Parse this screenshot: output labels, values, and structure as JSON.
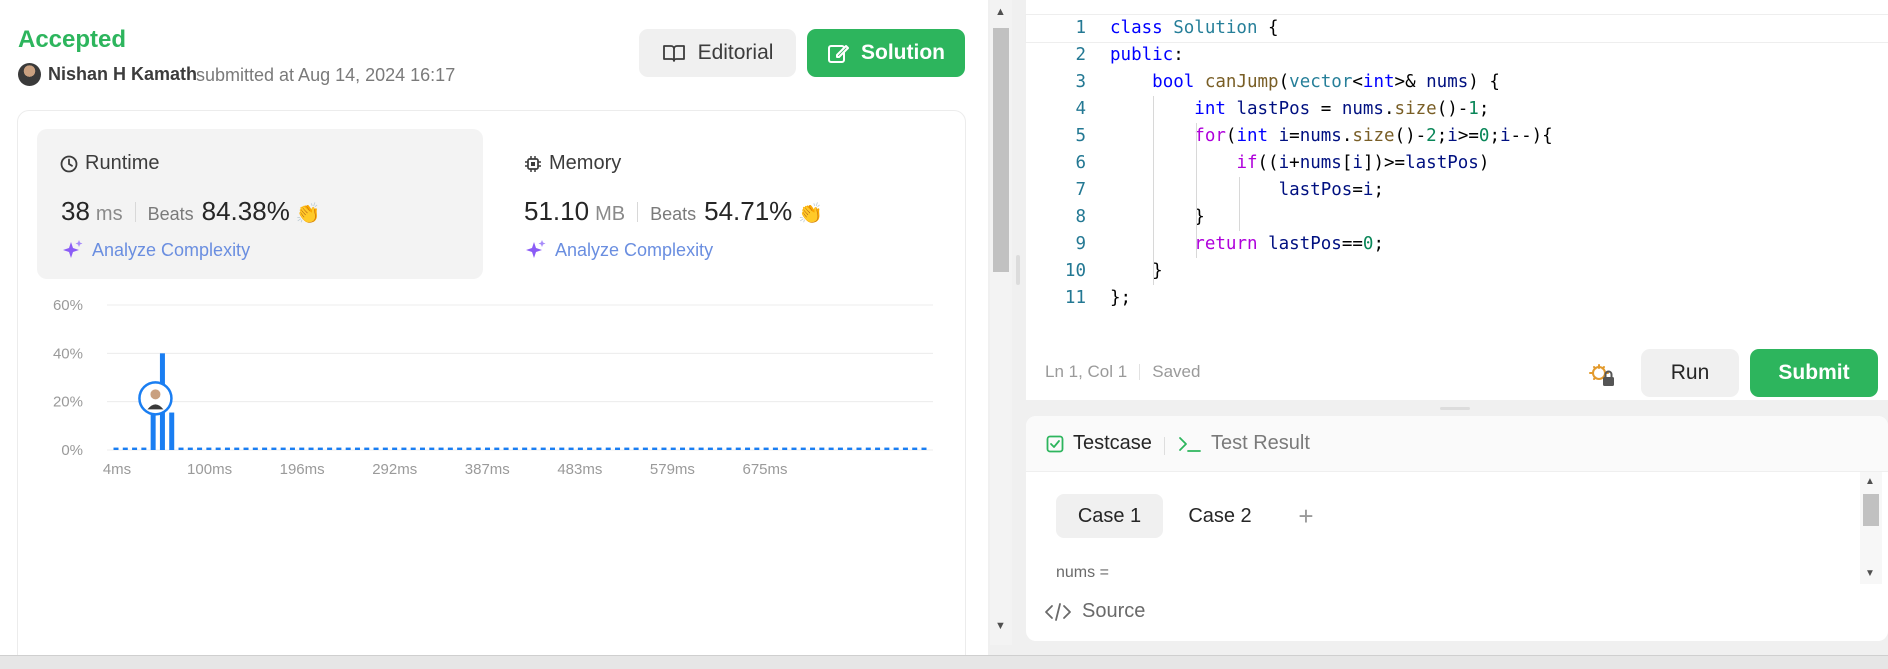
{
  "submission": {
    "status": "Accepted",
    "author": "Nishan H Kamath",
    "submitted_text": "submitted at Aug 14, 2024 16:17",
    "editorial_label": "Editorial",
    "solution_label": "Solution"
  },
  "runtime": {
    "label": "Runtime",
    "value": "38",
    "unit": "ms",
    "beats_label": "Beats",
    "beats_value": "84.38%",
    "analyze_label": "Analyze Complexity"
  },
  "memory": {
    "label": "Memory",
    "value": "51.10",
    "unit": "MB",
    "beats_label": "Beats",
    "beats_value": "54.71%",
    "analyze_label": "Analyze Complexity"
  },
  "chart_data": {
    "type": "bar",
    "ylim": [
      0,
      60
    ],
    "y_ticks": [
      "0%",
      "20%",
      "40%",
      "60%"
    ],
    "x_tick_labels": [
      "4ms",
      "100ms",
      "196ms",
      "292ms",
      "387ms",
      "483ms",
      "579ms",
      "675ms"
    ],
    "values": [
      1,
      1,
      1,
      1,
      20,
      40,
      15.5,
      1,
      1,
      1,
      1,
      1,
      1,
      1,
      1,
      1,
      1,
      1,
      1,
      1,
      1,
      1,
      1,
      1,
      1,
      1,
      1,
      1,
      1,
      1,
      1,
      1,
      1,
      1,
      1,
      1,
      1,
      1,
      1,
      1,
      1,
      1,
      1,
      1,
      1,
      1,
      1,
      1,
      1,
      1,
      1,
      1,
      1,
      1,
      1,
      1,
      1,
      1,
      1,
      1,
      1,
      1,
      1,
      1,
      1,
      1,
      1,
      1,
      1,
      1,
      1,
      1,
      1,
      1,
      1,
      1,
      1,
      1,
      1,
      1,
      1,
      1,
      1,
      1,
      1,
      1,
      1,
      1
    ],
    "user_bar_index": 5,
    "bar_color": "#1a7ef2",
    "grid": true
  },
  "editor": {
    "lines": [
      {
        "n": "1",
        "code": [
          [
            "class ",
            "#0000ff"
          ],
          [
            "Solution",
            "#267f99"
          ],
          [
            " {",
            "#000000"
          ]
        ]
      },
      {
        "n": "2",
        "code": [
          [
            "public",
            "#0000ff"
          ],
          [
            ":",
            "#000000"
          ]
        ]
      },
      {
        "n": "3",
        "code": [
          [
            "    ",
            "#000000"
          ],
          [
            "bool ",
            "#0000ff"
          ],
          [
            "canJump",
            "#795e26"
          ],
          [
            "(",
            "#000000"
          ],
          [
            "vector",
            "#267f99"
          ],
          [
            "<",
            "#000000"
          ],
          [
            "int",
            "#0000ff"
          ],
          [
            ">& ",
            "#000000"
          ],
          [
            "nums",
            "#001080"
          ],
          [
            ") {",
            "#000000"
          ]
        ]
      },
      {
        "n": "4",
        "code": [
          [
            "        ",
            "#000000"
          ],
          [
            "int ",
            "#0000ff"
          ],
          [
            "lastPos",
            "#001080"
          ],
          [
            " = ",
            "#000000"
          ],
          [
            "nums",
            "#001080"
          ],
          [
            ".",
            "#000000"
          ],
          [
            "size",
            "#795e26"
          ],
          [
            "()-",
            "#000000"
          ],
          [
            "1",
            "#098658"
          ],
          [
            ";",
            "#000000"
          ]
        ]
      },
      {
        "n": "5",
        "code": [
          [
            "        ",
            "#000000"
          ],
          [
            "for",
            "#af00db"
          ],
          [
            "(",
            "#000000"
          ],
          [
            "int ",
            "#0000ff"
          ],
          [
            "i",
            "#001080"
          ],
          [
            "=",
            "#000000"
          ],
          [
            "nums",
            "#001080"
          ],
          [
            ".",
            "#000000"
          ],
          [
            "size",
            "#795e26"
          ],
          [
            "()-",
            "#000000"
          ],
          [
            "2",
            "#098658"
          ],
          [
            ";",
            "#000000"
          ],
          [
            "i",
            "#001080"
          ],
          [
            ">=",
            "#000000"
          ],
          [
            "0",
            "#098658"
          ],
          [
            ";",
            "#000000"
          ],
          [
            "i",
            "#001080"
          ],
          [
            "--){",
            "#000000"
          ]
        ]
      },
      {
        "n": "6",
        "code": [
          [
            "            ",
            "#000000"
          ],
          [
            "if",
            "#af00db"
          ],
          [
            "((",
            "#000000"
          ],
          [
            "i",
            "#001080"
          ],
          [
            "+",
            "#000000"
          ],
          [
            "nums",
            "#001080"
          ],
          [
            "[",
            "#000000"
          ],
          [
            "i",
            "#001080"
          ],
          [
            "])>=",
            "#000000"
          ],
          [
            "lastPos",
            "#001080"
          ],
          [
            ")",
            "#000000"
          ]
        ]
      },
      {
        "n": "7",
        "code": [
          [
            "                ",
            "#000000"
          ],
          [
            "lastPos",
            "#001080"
          ],
          [
            "=",
            "#000000"
          ],
          [
            "i",
            "#001080"
          ],
          [
            ";",
            "#000000"
          ]
        ]
      },
      {
        "n": "8",
        "code": [
          [
            "        }",
            "#000000"
          ]
        ]
      },
      {
        "n": "9",
        "code": [
          [
            "        ",
            "#000000"
          ],
          [
            "return ",
            "#af00db"
          ],
          [
            "lastPos",
            "#001080"
          ],
          [
            "==",
            "#000000"
          ],
          [
            "0",
            "#098658"
          ],
          [
            ";",
            "#000000"
          ]
        ]
      },
      {
        "n": "10",
        "code": [
          [
            "    }",
            "#000000"
          ]
        ]
      },
      {
        "n": "11",
        "code": [
          [
            "};",
            "#000000"
          ]
        ]
      }
    ],
    "cursor_position": "Ln 1, Col 1",
    "save_status": "Saved",
    "run_label": "Run",
    "submit_label": "Submit"
  },
  "testcase": {
    "tab_testcase": "Testcase",
    "tab_result": "Test Result",
    "cases": [
      "Case 1",
      "Case 2"
    ],
    "add_case": "+",
    "param_label": "nums ="
  },
  "source_label": "Source",
  "colors": {
    "accent_green": "#2db55d",
    "bar_blue": "#1a7ef2",
    "analyze_purple": "#8b5cf6",
    "analyze_blue": "#6a8ee0"
  }
}
